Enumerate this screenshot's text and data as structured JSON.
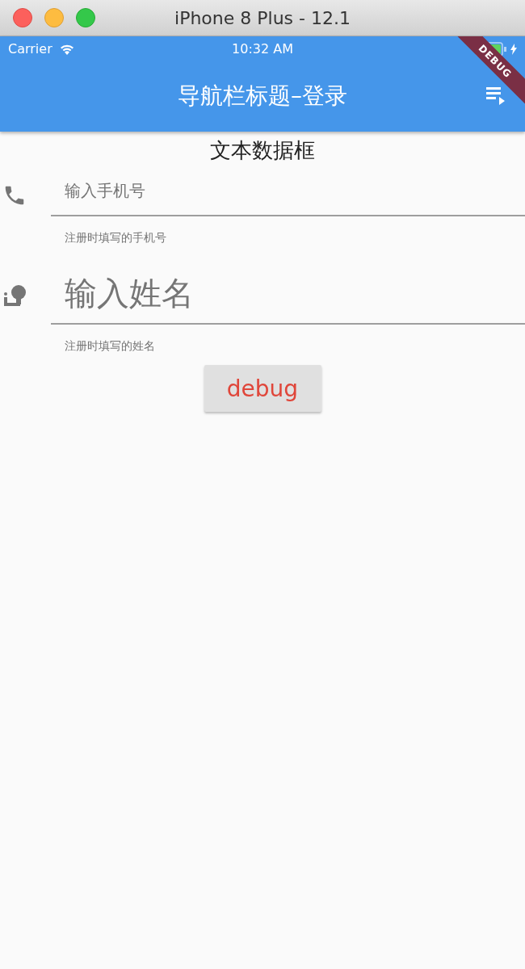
{
  "window": {
    "title": "iPhone 8 Plus - 12.1"
  },
  "status_bar": {
    "carrier": "Carrier",
    "time": "10:32 AM"
  },
  "app_bar": {
    "title": "导航栏标题–登录",
    "debug_banner": "DEBUG"
  },
  "heading": "文本数据框",
  "fields": [
    {
      "kind": "phone",
      "placeholder": "输入手机号",
      "helper": "注册时填写的手机号"
    },
    {
      "kind": "person",
      "placeholder": "输入姓名",
      "helper": "注册时填写的姓名"
    }
  ],
  "button": {
    "label": "debug"
  }
}
